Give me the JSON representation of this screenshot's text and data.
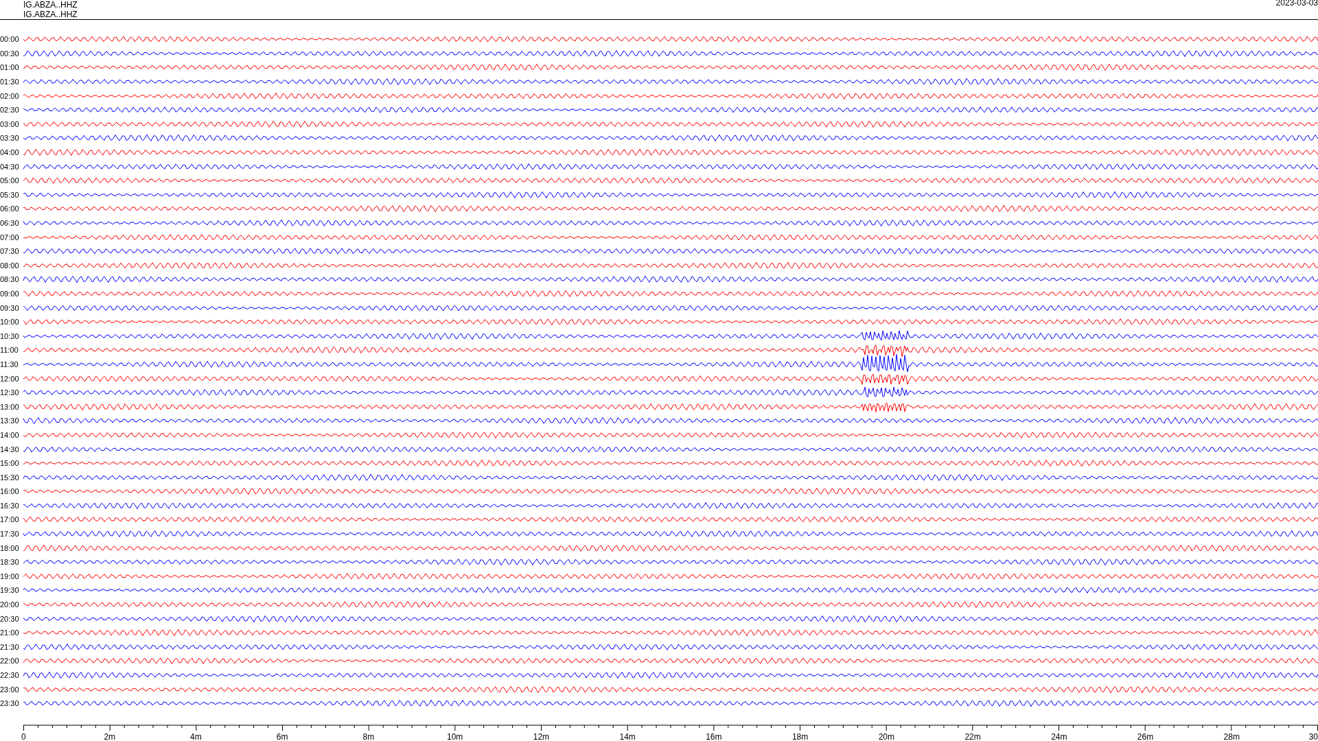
{
  "header": {
    "station_lines": [
      "IG.ABZA..HHZ",
      "IG.ABZA..HHZ"
    ],
    "date": "2023-03-03"
  },
  "rows": [
    {
      "label": "00:00",
      "color": "#ff0000"
    },
    {
      "label": "00:30",
      "color": "#0000ff"
    },
    {
      "label": "01:00",
      "color": "#ff0000"
    },
    {
      "label": "01:30",
      "color": "#0000ff"
    },
    {
      "label": "02:00",
      "color": "#ff0000"
    },
    {
      "label": "02:30",
      "color": "#0000ff"
    },
    {
      "label": "03:00",
      "color": "#ff0000"
    },
    {
      "label": "03:30",
      "color": "#0000ff"
    },
    {
      "label": "04:00",
      "color": "#ff0000"
    },
    {
      "label": "04:30",
      "color": "#0000ff"
    },
    {
      "label": "05:00",
      "color": "#ff0000"
    },
    {
      "label": "05:30",
      "color": "#0000ff"
    },
    {
      "label": "06:00",
      "color": "#ff0000"
    },
    {
      "label": "06:30",
      "color": "#0000ff"
    },
    {
      "label": "07:00",
      "color": "#ff0000"
    },
    {
      "label": "07:30",
      "color": "#0000ff"
    },
    {
      "label": "08:00",
      "color": "#ff0000"
    },
    {
      "label": "08:30",
      "color": "#0000ff"
    },
    {
      "label": "09:00",
      "color": "#ff0000"
    },
    {
      "label": "09:30",
      "color": "#0000ff"
    },
    {
      "label": "10:00",
      "color": "#ff0000"
    },
    {
      "label": "10:30",
      "color": "#0000ff"
    },
    {
      "label": "11:00",
      "color": "#ff0000"
    },
    {
      "label": "11:30",
      "color": "#0000ff"
    },
    {
      "label": "12:00",
      "color": "#ff0000"
    },
    {
      "label": "12:30",
      "color": "#0000ff"
    },
    {
      "label": "13:00",
      "color": "#ff0000"
    },
    {
      "label": "13:30",
      "color": "#0000ff"
    },
    {
      "label": "14:00",
      "color": "#ff0000"
    },
    {
      "label": "14:30",
      "color": "#0000ff"
    },
    {
      "label": "15:00",
      "color": "#ff0000"
    },
    {
      "label": "15:30",
      "color": "#0000ff"
    },
    {
      "label": "16:00",
      "color": "#ff0000"
    },
    {
      "label": "16:30",
      "color": "#0000ff"
    },
    {
      "label": "17:00",
      "color": "#ff0000"
    },
    {
      "label": "17:30",
      "color": "#0000ff"
    },
    {
      "label": "18:00",
      "color": "#ff0000"
    },
    {
      "label": "18:30",
      "color": "#0000ff"
    },
    {
      "label": "19:00",
      "color": "#ff0000"
    },
    {
      "label": "19:30",
      "color": "#0000ff"
    },
    {
      "label": "20:00",
      "color": "#ff0000"
    },
    {
      "label": "20:30",
      "color": "#0000ff"
    },
    {
      "label": "21:00",
      "color": "#ff0000"
    },
    {
      "label": "21:30",
      "color": "#0000ff"
    },
    {
      "label": "22:00",
      "color": "#ff0000"
    },
    {
      "label": "22:30",
      "color": "#0000ff"
    },
    {
      "label": "23:00",
      "color": "#ff0000"
    },
    {
      "label": "23:30",
      "color": "#0000ff"
    }
  ],
  "x_axis": {
    "tick_labels": [
      "0",
      "2m",
      "4m",
      "6m",
      "8m",
      "10m",
      "12m",
      "14m",
      "16m",
      "18m",
      "20m",
      "22m",
      "24m",
      "26m",
      "28m",
      "30"
    ]
  }
}
